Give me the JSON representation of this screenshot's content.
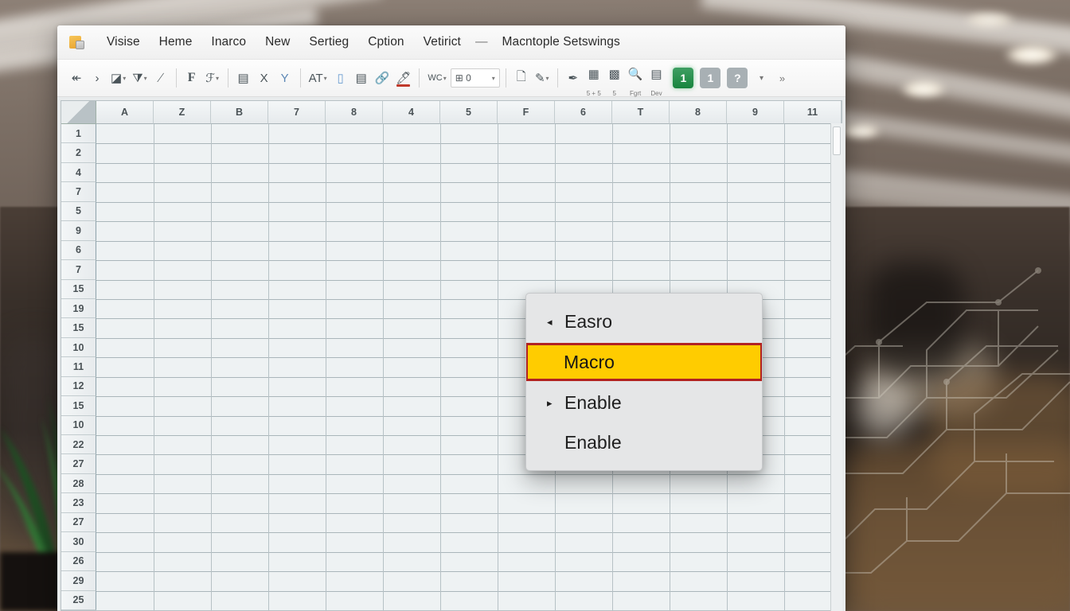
{
  "window": {
    "app_icon": "document-icon",
    "menu_items": [
      "Visise",
      "Heme",
      "Inarco",
      "New",
      "Sertieg",
      "Cption",
      "Vetirict"
    ],
    "menu_separator": "—",
    "menu_trailing": "Macntople Setswings"
  },
  "toolbar": {
    "items": [
      {
        "name": "back-arrow-icon",
        "glyph": "↞",
        "caret": false
      },
      {
        "name": "forward-arrow-icon",
        "glyph": "›",
        "caret": false
      },
      {
        "name": "paint-format-icon",
        "glyph": "◪",
        "caret": true
      },
      {
        "name": "fill-bucket-icon",
        "glyph": "⧩",
        "caret": true
      },
      {
        "name": "italic-slash-icon",
        "glyph": "∕",
        "caret": false
      },
      {
        "name": "bold-font-icon",
        "glyph": "F",
        "caret": false
      },
      {
        "name": "font-style-icon",
        "glyph": "ℱ",
        "caret": true
      },
      {
        "name": "align-icon",
        "glyph": "▤",
        "caret": false
      },
      {
        "name": "close-x-icon",
        "glyph": "X",
        "caret": false
      },
      {
        "name": "filter-funnel-icon",
        "glyph": "Y",
        "caret": false
      },
      {
        "name": "text-size-icon",
        "glyph": "AT",
        "caret": true
      },
      {
        "name": "cell-insert-icon",
        "glyph": "▯",
        "caret": false
      },
      {
        "name": "table-icon",
        "glyph": "▤",
        "caret": false
      },
      {
        "name": "link-icon",
        "glyph": "🔗",
        "caret": false
      },
      {
        "name": "highlighter-pen-icon",
        "glyph": "🖊",
        "caret": false
      },
      {
        "name": "wrap-text-icon",
        "glyph": "WC",
        "caret": true
      }
    ],
    "select_value": "⊞ 0",
    "right_items": [
      {
        "name": "copy-page-icon",
        "glyph": "🗋",
        "caret": false,
        "sub": ""
      },
      {
        "name": "pencil-edit-icon",
        "glyph": "✎",
        "caret": true,
        "sub": ""
      },
      {
        "name": "marker-icon",
        "glyph": "✒",
        "caret": false,
        "sub": ""
      },
      {
        "name": "formula-sum-icon",
        "glyph": "▦",
        "caret": false,
        "sub": "5 + 5"
      },
      {
        "name": "function-icon",
        "glyph": "▩",
        "caret": false,
        "sub": "5"
      },
      {
        "name": "search-icon",
        "glyph": "🔍",
        "caret": false,
        "sub": "Fgrt"
      },
      {
        "name": "developer-icon",
        "glyph": "▤",
        "caret": false,
        "sub": "Dev"
      }
    ],
    "badges": [
      {
        "name": "badge-green-one",
        "label": "1",
        "color": "#17843d",
        "style": "green"
      },
      {
        "name": "badge-gray-one",
        "label": "1",
        "color": "#a8b0b4",
        "style": "gray"
      },
      {
        "name": "badge-help",
        "label": "?",
        "color": "#a8b0b4",
        "style": "gray"
      }
    ],
    "overflow_caret": "▾",
    "expand_chevron": "»"
  },
  "sheet": {
    "column_headers": [
      "A",
      "Z",
      "B",
      "7",
      "8",
      "4",
      "5",
      "F",
      "6",
      "T",
      "8",
      "9",
      "11"
    ],
    "row_headers": [
      "1",
      "2",
      "4",
      "7",
      "5",
      "9",
      "6",
      "7",
      "15",
      "19",
      "15",
      "10",
      "11",
      "12",
      "15",
      "10",
      "22",
      "27",
      "28",
      "23",
      "27",
      "30",
      "26",
      "29",
      "25"
    ]
  },
  "dropdown": {
    "items": [
      {
        "arrow": "◂",
        "label": "Easro",
        "highlighted": false
      },
      {
        "arrow": "",
        "label": "Macro",
        "highlighted": true
      },
      {
        "arrow": "▸",
        "label": "Enable",
        "highlighted": false
      },
      {
        "arrow": "",
        "label": "Enable",
        "highlighted": false
      }
    ],
    "highlight_fill": "#ffcc00",
    "highlight_border": "#b12222"
  }
}
